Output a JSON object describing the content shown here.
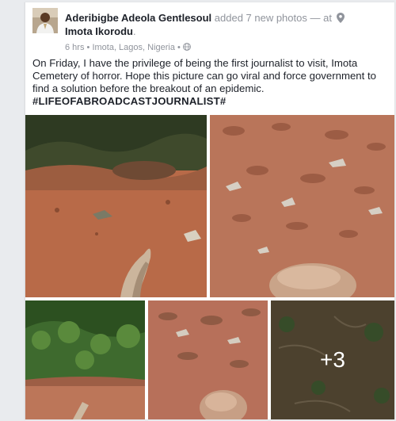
{
  "post": {
    "author": "Aderibigbe Adeola Gentlesoul",
    "action": " added 7 new photos — at ",
    "place": "Imota Ikorodu",
    "place_suffix": ".",
    "time": "6 hrs",
    "location": "Imota, Lagos, Nigeria",
    "separator": " • ",
    "privacy_icon": "globe-icon",
    "body": "On Friday, I have the privilege of being the first journalist to visit, Imota Cemetery of horror. Hope this picture can go viral and force government to find a solution before  the breakout of an epidemic.",
    "hashtag": "#LIFEOFABROADCASTJOURNALIST#",
    "more_photos": "+3"
  }
}
